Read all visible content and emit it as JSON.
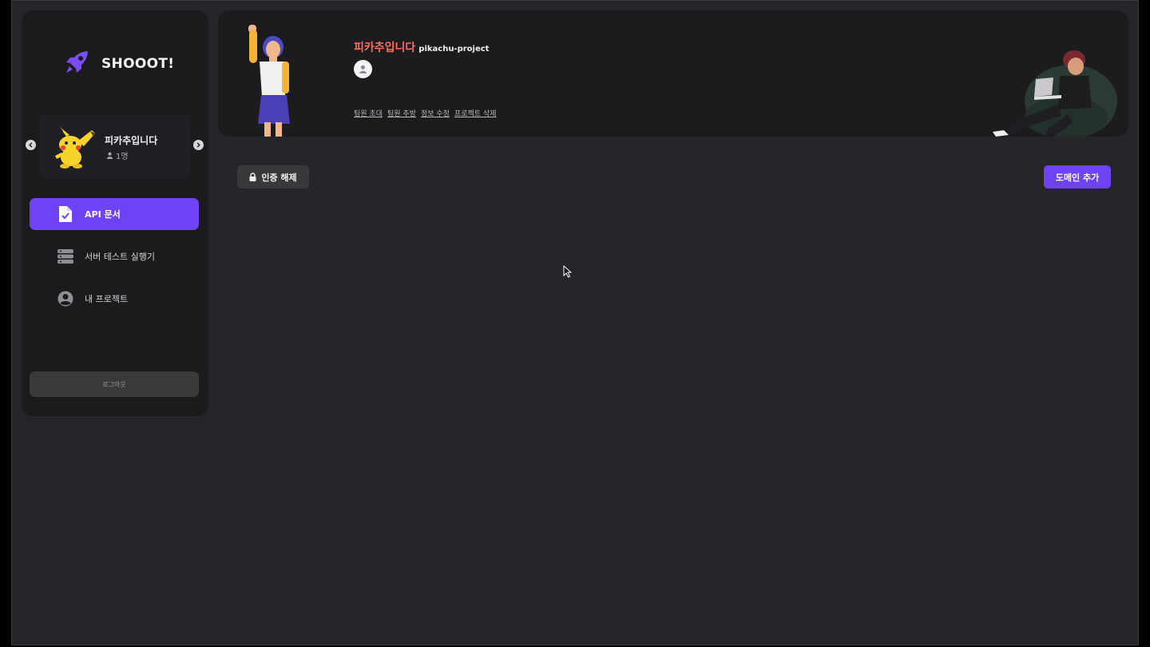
{
  "app": {
    "brand": "SHOOOT!",
    "accent_color": "#6f42f5",
    "title_color": "#ff6b5c"
  },
  "sidebar": {
    "project_card": {
      "name": "피카추입니다",
      "members": "1명",
      "avatar_icon": "pikachu-avatar",
      "prev_icon": "chevron-left-icon",
      "next_icon": "chevron-right-icon"
    },
    "nav": [
      {
        "label": "API 문서",
        "icon": "document-check-icon",
        "active": true
      },
      {
        "label": "서버 테스트 실행기",
        "icon": "server-stack-icon",
        "active": false
      },
      {
        "label": "내 프로젝트",
        "icon": "user-circle-icon",
        "active": false
      }
    ],
    "logout_label": "로그아웃"
  },
  "header": {
    "project_name": "피카추입니다",
    "project_slug": "pikachu-project",
    "links": [
      "팀원 초대",
      "팀원 추방",
      "정보 수정",
      "프로젝트 삭제"
    ]
  },
  "toolbar": {
    "unlock_label": "인증 해제",
    "add_domain_label": "도메인 추가"
  }
}
